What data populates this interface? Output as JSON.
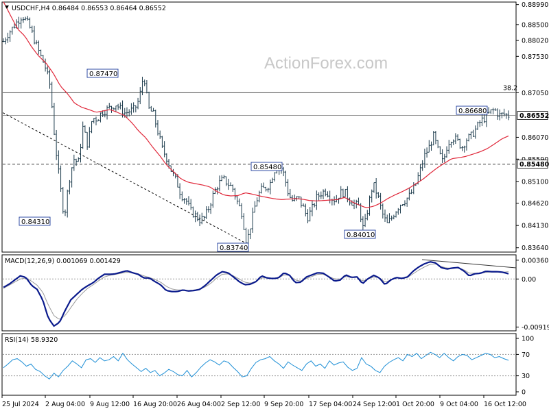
{
  "watermark": "ActionForex.com",
  "chart_data": [
    {
      "type": "candlestick",
      "title": "USDCHF,H4 0.86484 0.86553 0.86464 0.86552",
      "y_ticks": [
        0.8899,
        0.8855,
        0.882,
        0.8785,
        0.8705,
        0.8655,
        0.8607,
        0.8559,
        0.8548,
        0.851,
        0.8462,
        0.8413,
        0.8364
      ],
      "y_tick_labels": [
        "0.88990",
        "0.88500",
        "0.88020",
        "0.87530",
        "0.87050",
        "0.86552",
        "0.86070",
        "0.85590",
        "0.85480",
        "0.85100",
        "0.84620",
        "0.84130",
        "0.83640"
      ],
      "horizontal_lines": [
        {
          "value": 0.8705,
          "label": "38.2",
          "color": "#444444",
          "style": "solid"
        },
        {
          "value": 0.86552,
          "color": "#9a9a9a",
          "style": "solid"
        },
        {
          "value": 0.8548,
          "color": "#333333",
          "style": "dashed"
        }
      ],
      "current_price": "0.86552",
      "level_price": "0.85480",
      "trendline": {
        "from": [
          "25 Jul 2024",
          0.8661
        ],
        "to": [
          "4 Sep 2024",
          0.8374
        ],
        "style": "dotted"
      },
      "annotations": [
        {
          "text": "0.84310",
          "x": "1 Aug 2024",
          "y": 0.8431
        },
        {
          "text": "0.87470",
          "x": "12 Aug 2024",
          "y": 0.8747
        },
        {
          "text": "0.83740",
          "x": "5 Sep 2024",
          "y": 0.8374
        },
        {
          "text": "0.85480",
          "x": "12 Sep 2024",
          "y": 0.8548
        },
        {
          "text": "0.84010",
          "x": "27 Sep 2024",
          "y": 0.8401
        },
        {
          "text": "0.86680",
          "x": "15 Oct 2024",
          "y": 0.8668
        }
      ],
      "x_labels": [
        "25 Jul 2024",
        "2 Aug 04:00",
        "9 Aug 12:00",
        "16 Aug 20:00",
        "26 Aug 04:00",
        "2 Sep 12:00",
        "9 Sep 20:00",
        "17 Sep 04:00",
        "24 Sep 12:00",
        "1 Oct 20:00",
        "9 Oct 04:00",
        "16 Oct 12:00"
      ],
      "close_path": [
        0.8818,
        0.8835,
        0.8848,
        0.8862,
        0.8875,
        0.8862,
        0.884,
        0.881,
        0.8785,
        0.876,
        0.872,
        0.86,
        0.851,
        0.8431,
        0.851,
        0.856,
        0.855,
        0.863,
        0.859,
        0.865,
        0.8647,
        0.8662,
        0.8668,
        0.8673,
        0.868,
        0.867,
        0.866,
        0.8665,
        0.8668,
        0.869,
        0.8747,
        0.867,
        0.866,
        0.862,
        0.858,
        0.856,
        0.853,
        0.851,
        0.848,
        0.847,
        0.8445,
        0.8435,
        0.8425,
        0.843,
        0.8455,
        0.8485,
        0.8505,
        0.8515,
        0.8505,
        0.8495,
        0.8465,
        0.844,
        0.8374,
        0.842,
        0.8465,
        0.849,
        0.8495,
        0.8505,
        0.8535,
        0.8548,
        0.8525,
        0.848,
        0.8465,
        0.8475,
        0.8455,
        0.843,
        0.845,
        0.8475,
        0.8485,
        0.849,
        0.8475,
        0.8468,
        0.8485,
        0.8485,
        0.847,
        0.846,
        0.8455,
        0.8401,
        0.8455,
        0.8505,
        0.848,
        0.844,
        0.8415,
        0.843,
        0.8448,
        0.8462,
        0.847,
        0.848,
        0.85,
        0.853,
        0.8565,
        0.8585,
        0.861,
        0.8575,
        0.855,
        0.8595,
        0.8607,
        0.86,
        0.8585,
        0.8602,
        0.861,
        0.8625,
        0.8642,
        0.865,
        0.8662,
        0.8668,
        0.8655,
        0.8658,
        0.8655
      ],
      "sma_path": [
        0.8905,
        0.8875,
        0.8845,
        0.883,
        0.8805,
        0.8785,
        0.877,
        0.8748,
        0.872,
        0.8703,
        0.8682,
        0.8673,
        0.8668,
        0.8662,
        0.8665,
        0.8668,
        0.8662,
        0.8655,
        0.864,
        0.8621,
        0.8606,
        0.8585,
        0.8566,
        0.8545,
        0.853,
        0.8515,
        0.8508,
        0.8505,
        0.8502,
        0.8498,
        0.8488,
        0.848,
        0.8478,
        0.8479,
        0.8485,
        0.8482,
        0.8478,
        0.8475,
        0.8472,
        0.847,
        0.8471,
        0.8472,
        0.8471,
        0.8468,
        0.8467,
        0.8468,
        0.8469,
        0.847,
        0.8475,
        0.8465,
        0.8458,
        0.8452,
        0.8455,
        0.8462,
        0.8472,
        0.848,
        0.8487,
        0.8495,
        0.8505,
        0.8515,
        0.8528,
        0.854,
        0.855,
        0.856,
        0.8562,
        0.8565,
        0.857,
        0.8575,
        0.8582,
        0.8592,
        0.8603,
        0.861
      ]
    },
    {
      "type": "line",
      "title": "MACD(12,26,9) 0.001069 0.001429",
      "y_ticks": [
        0.003603,
        0.0,
        -0.009198
      ],
      "y_tick_labels": [
        "0.003603",
        "0.00",
        "-0.009198"
      ],
      "macd_path": [
        -0.0016,
        -0.001,
        -0.0002,
        0.0006,
        0.0003,
        -0.0012,
        -0.002,
        -0.004,
        -0.0075,
        -0.009,
        -0.0083,
        -0.006,
        -0.004,
        -0.003,
        -0.002,
        -0.0013,
        -0.0007,
        0.0002,
        0.0009,
        0.0009,
        0.001,
        0.0013,
        0.0016,
        0.0012,
        0.0009,
        0.0002,
        0.0002,
        -0.0005,
        -0.0011,
        -0.0022,
        -0.0024,
        -0.0024,
        -0.0021,
        -0.0023,
        -0.0022,
        -0.002,
        -0.0012,
        -0.0002,
        0.0008,
        0.0014,
        0.0012,
        0.0004,
        -0.0005,
        -0.0011,
        -0.001,
        -0.0005,
        0.0006,
        0.0002,
        0.0001,
        0.0002,
        0.0012,
        0.0007,
        -0.0007,
        -0.0006,
        0.0004,
        0.0008,
        0.0012,
        0.0011,
        0.0004,
        -0.0004,
        -0.0002,
        0.0008,
        0.0003,
        0.0004,
        -0.0009,
        0.0001,
        0.0007,
        0.0002,
        -0.0011,
        -0.0002,
        0.0003,
        0.0001,
        0.0004,
        0.0015,
        0.0023,
        0.0029,
        0.0033,
        0.0031,
        0.0022,
        0.0019,
        0.0021,
        0.0022,
        0.0016,
        0.0006,
        0.001,
        0.0011,
        0.0015,
        0.0014,
        0.0014,
        0.0013,
        0.001
      ],
      "signal_path": [
        -0.0018,
        -0.0012,
        -0.0006,
        0.0,
        0.0002,
        -0.0004,
        -0.0012,
        -0.0025,
        -0.005,
        -0.007,
        -0.0078,
        -0.007,
        -0.0055,
        -0.004,
        -0.0028,
        -0.0018,
        -0.0011,
        -0.0003,
        0.0004,
        0.0007,
        0.0009,
        0.0011,
        0.0013,
        0.0012,
        0.001,
        0.0006,
        0.0003,
        -0.0001,
        -0.0006,
        -0.0014,
        -0.0019,
        -0.0021,
        -0.0021,
        -0.0022,
        -0.0021,
        -0.0019,
        -0.0015,
        -0.0008,
        0.0002,
        0.0009,
        0.001,
        0.0006,
        0.0,
        -0.0006,
        -0.0008,
        -0.0005,
        0.0002,
        0.0002,
        0.0001,
        0.0002,
        0.0008,
        0.0007,
        -0.0002,
        -0.0004,
        0.0001,
        0.0005,
        0.0009,
        0.0009,
        0.0005,
        0.0,
        0.0,
        0.0005,
        0.0003,
        0.0003,
        -0.0004,
        0.0,
        0.0004,
        0.0002,
        -0.0006,
        -0.0002,
        0.0002,
        0.0001,
        0.0003,
        0.001,
        0.0017,
        0.0023,
        0.0028,
        0.0029,
        0.0024,
        0.0021,
        0.0021,
        0.0021,
        0.0018,
        0.0011,
        0.0011,
        0.0011,
        0.0013,
        0.0013,
        0.0013,
        0.0013,
        0.0014
      ]
    },
    {
      "type": "line",
      "title": "RSI(14) 58.9320",
      "y_ticks": [
        100,
        70,
        30,
        0
      ],
      "y_tick_labels": [
        "100",
        "70",
        "30",
        "0"
      ],
      "levels": [
        70,
        30
      ],
      "rsi_path": [
        45,
        52,
        60,
        62,
        56,
        48,
        52,
        42,
        38,
        30,
        24,
        35,
        28,
        40,
        48,
        58,
        52,
        45,
        60,
        62,
        55,
        64,
        58,
        60,
        66,
        58,
        72,
        60,
        52,
        45,
        38,
        44,
        36,
        40,
        30,
        35,
        42,
        38,
        32,
        30,
        40,
        28,
        36,
        46,
        54,
        60,
        56,
        50,
        58,
        55,
        46,
        38,
        28,
        30,
        44,
        55,
        60,
        62,
        66,
        58,
        52,
        44,
        56,
        50,
        45,
        40,
        52,
        58,
        48,
        52,
        44,
        58,
        50,
        54,
        56,
        46,
        40,
        44,
        64,
        52,
        48,
        40,
        36,
        48,
        55,
        60,
        64,
        58,
        70,
        66,
        72,
        62,
        68,
        74,
        70,
        64,
        72,
        64,
        58,
        66,
        70,
        68,
        60,
        64,
        68,
        72,
        70,
        64,
        66,
        62,
        59
      ]
    }
  ]
}
